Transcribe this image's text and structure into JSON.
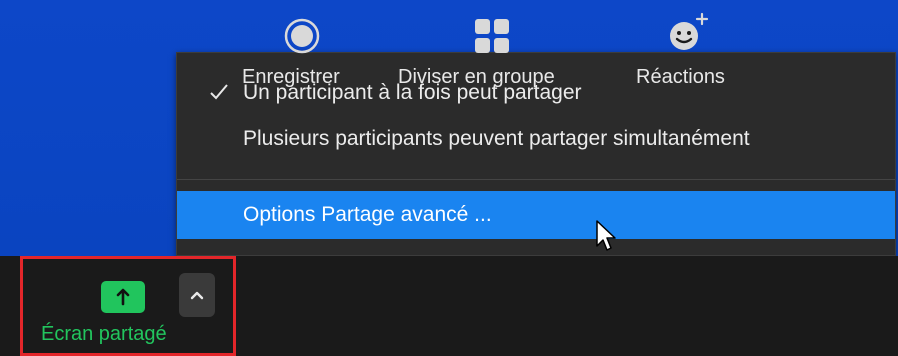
{
  "menu": {
    "items": [
      {
        "label": "Un participant à la fois peut partager",
        "checked": true
      },
      {
        "label": "Plusieurs participants peuvent partager simultanément",
        "checked": false
      },
      {
        "label": "Options Partage avancé ...",
        "checked": false,
        "highlighted": true
      }
    ]
  },
  "toolbar": {
    "share_label": "Écran partagé",
    "record_label": "Enregistrer",
    "breakout_label": "Diviser en groupe",
    "reactions_label": "Réactions"
  },
  "colors": {
    "background_blue": "#0c4ac4",
    "menu_bg": "#2b2b2b",
    "highlight": "#1a84f0",
    "share_green": "#21c55d",
    "share_outline": "#e3262a",
    "toolbar_bg": "#1a1a1a"
  }
}
